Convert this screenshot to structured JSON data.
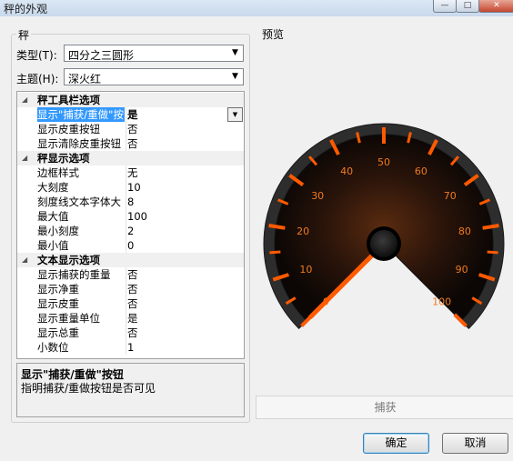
{
  "window": {
    "title": "秤的外观",
    "min_label": "—",
    "max_label": "□",
    "close_label": "✕"
  },
  "left_group": {
    "title": "秤",
    "type_label": "类型(T):",
    "type_value": "四分之三圆形",
    "theme_label": "主题(H):",
    "theme_value": "深火红"
  },
  "properties": {
    "categories": [
      {
        "title": "秤工具栏选项",
        "rows": [
          {
            "name": "显示\"捕获/重做\"按",
            "value": "是",
            "selected": true
          },
          {
            "name": "显示皮重按钮",
            "value": "否"
          },
          {
            "name": "显示清除皮重按钮",
            "value": "否"
          }
        ]
      },
      {
        "title": "秤显示选项",
        "rows": [
          {
            "name": "边框样式",
            "value": "无"
          },
          {
            "name": "大刻度",
            "value": "10"
          },
          {
            "name": "刻度线文本字体大",
            "value": "8"
          },
          {
            "name": "最大值",
            "value": "100"
          },
          {
            "name": "最小刻度",
            "value": "2"
          },
          {
            "name": "最小值",
            "value": "0"
          }
        ]
      },
      {
        "title": "文本显示选项",
        "rows": [
          {
            "name": "显示捕获的重量",
            "value": "否"
          },
          {
            "name": "显示净重",
            "value": "否"
          },
          {
            "name": "显示皮重",
            "value": "否"
          },
          {
            "name": "显示重量单位",
            "value": "是"
          },
          {
            "name": "显示总重",
            "value": "否"
          },
          {
            "name": "小数位",
            "value": "1"
          }
        ]
      }
    ]
  },
  "description": {
    "title": "显示\"捕获/重做\"按钮",
    "text": "指明捕获/重做按钮是否可见"
  },
  "preview": {
    "title": "预览",
    "capture_label": "捕获",
    "gauge": {
      "min": 0,
      "max": 100,
      "major_step": 10,
      "minor_ticks_per_major": 5,
      "value": 0,
      "labels": [
        "0",
        "10",
        "20",
        "30",
        "40",
        "50",
        "60",
        "70",
        "80",
        "90",
        "100"
      ],
      "accent_color": "#ff5a00",
      "label_color": "#f07a1e"
    }
  },
  "buttons": {
    "ok": "确定",
    "cancel": "取消"
  }
}
